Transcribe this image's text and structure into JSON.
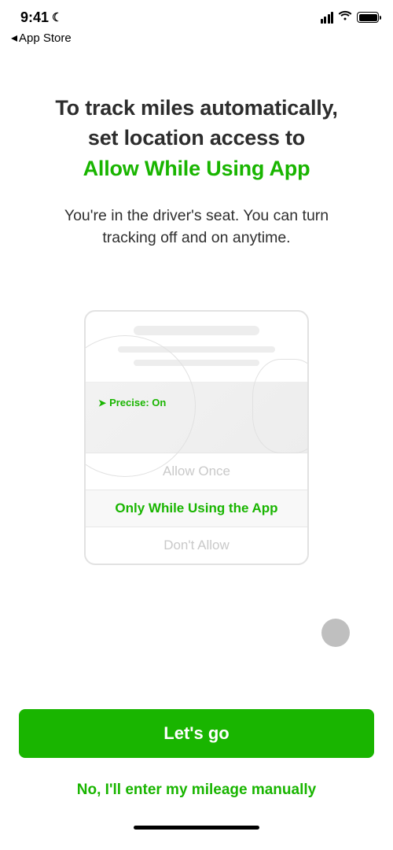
{
  "status": {
    "time": "9:41",
    "back_label": "App Store"
  },
  "headline": {
    "line1": "To track miles automatically,",
    "line2": "set location access to",
    "accent": "Allow While Using App"
  },
  "subtext": {
    "line1": "You're in the driver's seat. You can turn",
    "line2": "tracking off and on anytime."
  },
  "dialog": {
    "precise_label": "Precise: On",
    "options": {
      "allow_once": "Allow Once",
      "only_while": "Only While Using the App",
      "dont_allow": "Don't Allow"
    }
  },
  "cta": {
    "primary": "Let's go",
    "secondary": "No, I'll enter my mileage manually"
  },
  "colors": {
    "accent": "#19b500"
  }
}
